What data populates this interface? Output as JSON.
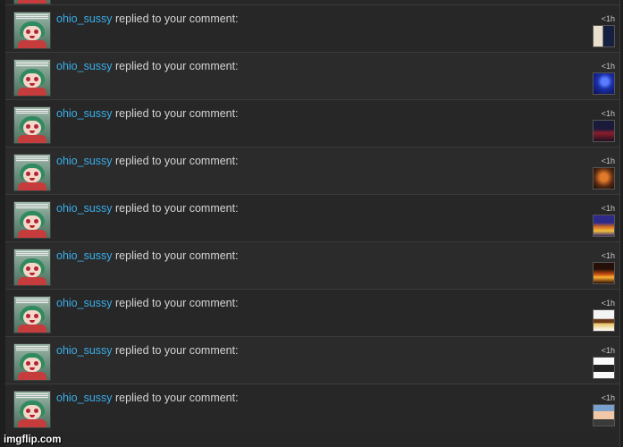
{
  "feed": {
    "items": [
      {
        "user": "ohio_sussy",
        "action": " replied to your comment:",
        "time": "<1h",
        "thumb": "t1"
      },
      {
        "user": "ohio_sussy",
        "action": " replied to your comment:",
        "time": "<1h",
        "thumb": "t2"
      },
      {
        "user": "ohio_sussy",
        "action": " replied to your comment:",
        "time": "<1h",
        "thumb": "t3"
      },
      {
        "user": "ohio_sussy",
        "action": " replied to your comment:",
        "time": "<1h",
        "thumb": "t4"
      },
      {
        "user": "ohio_sussy",
        "action": " replied to your comment:",
        "time": "<1h",
        "thumb": "t5"
      },
      {
        "user": "ohio_sussy",
        "action": " replied to your comment:",
        "time": "<1h",
        "thumb": "t6"
      },
      {
        "user": "ohio_sussy",
        "action": " replied to your comment:",
        "time": "<1h",
        "thumb": "t7"
      },
      {
        "user": "ohio_sussy",
        "action": " replied to your comment:",
        "time": "<1h",
        "thumb": "t8"
      },
      {
        "user": "ohio_sussy",
        "action": " replied to your comment:",
        "time": "<1h",
        "thumb": "t9"
      }
    ]
  },
  "watermark": "imgflip.com",
  "colors": {
    "username": "#3aaeea",
    "background": "#272727",
    "text": "#d4d4d4"
  }
}
